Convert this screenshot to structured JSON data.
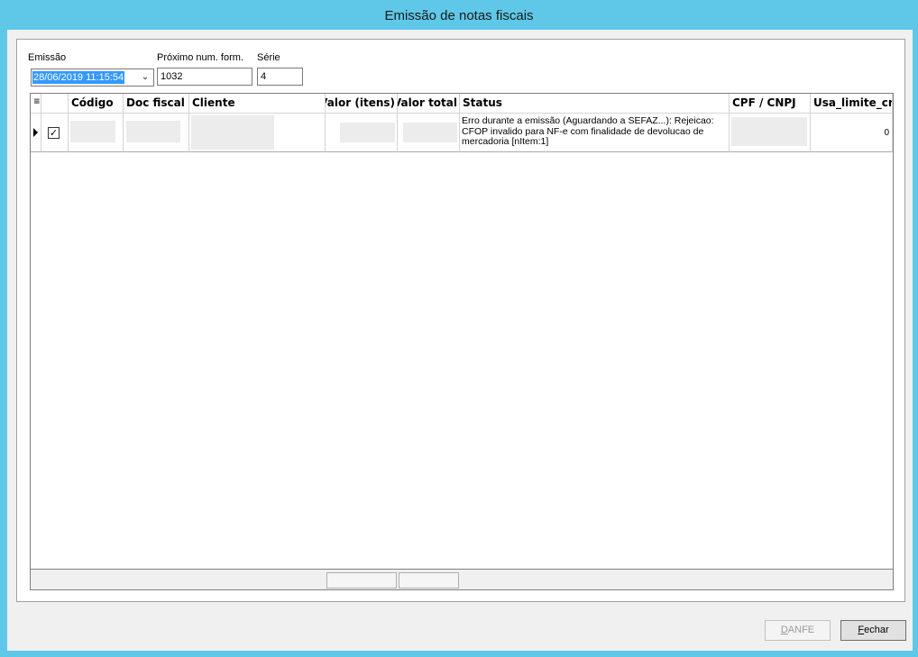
{
  "window": {
    "title": "Emissão de notas fiscais"
  },
  "form": {
    "emissao_label": "Emissão",
    "emissao_value": "28/06/2019 11:15:54",
    "proximo_label": "Próximo num. form.",
    "proximo_value": "1032",
    "serie_label": "Série",
    "serie_value": "4"
  },
  "grid": {
    "columns": [
      "Código",
      "Doc fiscal",
      "Cliente",
      "Valor (itens)",
      "Valor total",
      "Status",
      "CPF / CNPJ",
      "Usa_limite_cr"
    ],
    "rows": [
      {
        "checked": true,
        "codigo": "",
        "doc_fiscal": "",
        "cliente": "",
        "valor_itens": "",
        "valor_total": "",
        "status": "Erro durante a emissão (Aguardando a SEFAZ...): Rejeicao: CFOP invalido para NF-e com finalidade de devolucao de mercadoria [nItem:1]",
        "cpf_cnpj": "",
        "usa_limite": "0"
      }
    ]
  },
  "buttons": {
    "danfe_prefix": "",
    "danfe_key": "D",
    "danfe_rest": "ANFE",
    "fechar_key": "F",
    "fechar_rest": "echar"
  }
}
